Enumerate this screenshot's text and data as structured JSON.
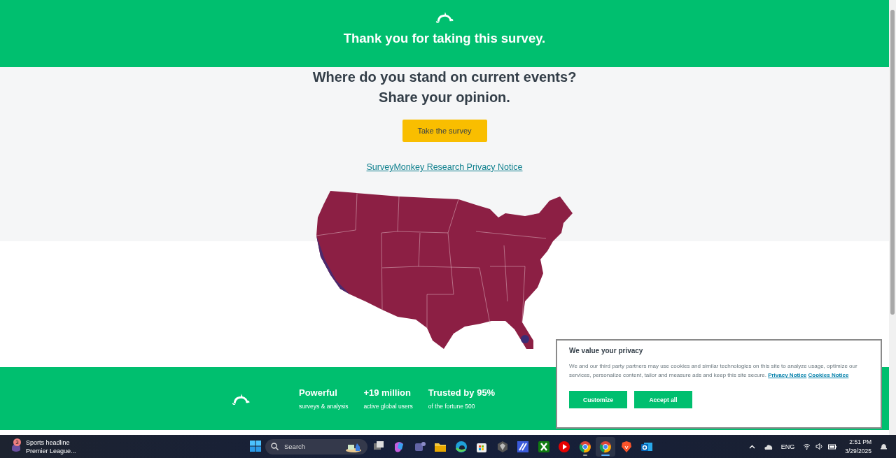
{
  "header": {
    "title": "Thank you for taking this survey."
  },
  "hero": {
    "heading_lines": [
      "Where do you stand on current events?",
      "Share your opinion."
    ],
    "button": "Take the survey",
    "link": "SurveyMonkey Research Privacy Notice"
  },
  "footer": {
    "stats": [
      {
        "title": "Powerful",
        "subtitle": "surveys & analysis"
      },
      {
        "title": "+19 million",
        "subtitle": "active global users"
      },
      {
        "title": "Trusted by 95%",
        "subtitle": "of the fortune 500"
      }
    ]
  },
  "cookie_dialog": {
    "title": "We value your privacy",
    "body": "We and our third party partners may use cookies and similar technologies on this site to analyze usage, optimize our services, personalize content, tailor and measure ads and keep this site secure.",
    "links": [
      "Privacy Notice",
      "Cookies Notice"
    ],
    "buttons": [
      "Customize",
      "Accept all"
    ]
  },
  "taskbar": {
    "widget": {
      "badge": "3",
      "title": "Sports headline",
      "subtitle": "Premier League..."
    },
    "search": {
      "placeholder": "Search"
    },
    "apps": [
      {
        "kind": "taskview",
        "selected": false,
        "running": false
      },
      {
        "kind": "copilot",
        "selected": false,
        "running": false
      },
      {
        "kind": "teams",
        "selected": false,
        "running": false
      },
      {
        "kind": "folder",
        "selected": false,
        "running": false
      },
      {
        "kind": "edge",
        "selected": false,
        "running": false
      },
      {
        "kind": "store",
        "selected": false,
        "running": false
      },
      {
        "kind": "cube",
        "selected": false,
        "running": false
      },
      {
        "kind": "pen",
        "selected": false,
        "running": false
      },
      {
        "kind": "xbox",
        "selected": false,
        "running": false
      },
      {
        "kind": "youtube",
        "selected": false,
        "running": false
      },
      {
        "kind": "chrome",
        "selected": false,
        "running": true
      },
      {
        "kind": "chrome",
        "selected": true,
        "running": true
      },
      {
        "kind": "brave",
        "selected": false,
        "running": false
      },
      {
        "kind": "outlook",
        "selected": false,
        "running": false
      }
    ],
    "tray": {
      "language": "ENG",
      "time": "2:51 PM",
      "date": "3/29/2025"
    }
  }
}
